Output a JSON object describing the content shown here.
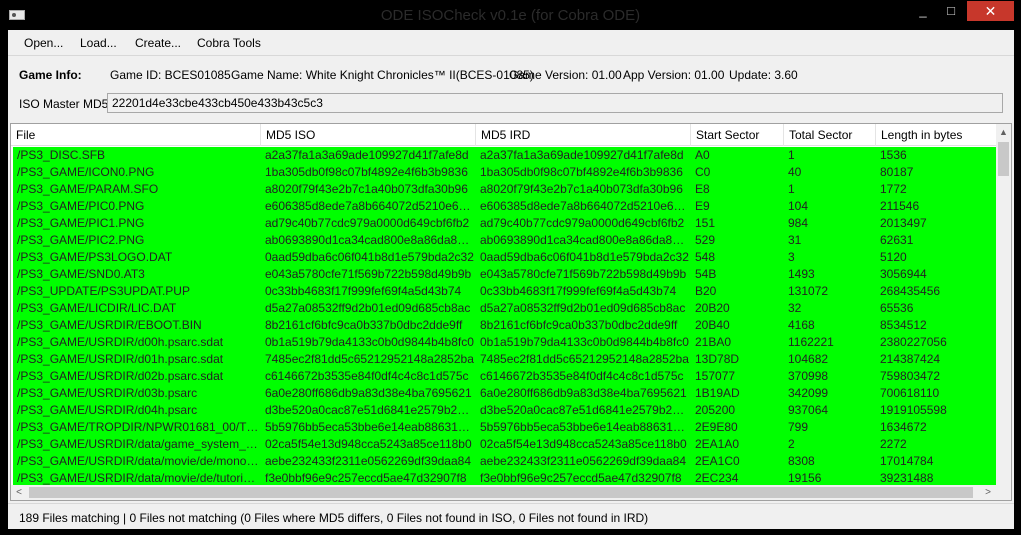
{
  "window": {
    "title": "ODE ISOCheck v0.1e (for Cobra ODE)",
    "minimize": "_",
    "maximize": "□",
    "close": "✕"
  },
  "menu": {
    "open": "Open...",
    "load": "Load...",
    "create": "Create...",
    "cobra_tools": "Cobra Tools"
  },
  "game_info": {
    "label": "Game Info:",
    "game_id": "Game ID: BCES01085",
    "game_name": "Game Name: White Knight Chronicles™ II(BCES-01085)",
    "game_version": "Game Version: 01.00",
    "app_version": "App Version: 01.00",
    "update": "Update: 3.60"
  },
  "iso_md5": {
    "label": "ISO Master MD5:",
    "value": "22201d4e33cbe433cb450e433b43c5c3"
  },
  "table": {
    "columns": [
      "File",
      "MD5 ISO",
      "MD5 IRD",
      "Start Sector",
      "Total Sector",
      "Length in bytes"
    ],
    "rows": [
      [
        "/PS3_DISC.SFB",
        "a2a37fa1a3a69ade109927d41f7afe8d",
        "a2a37fa1a3a69ade109927d41f7afe8d",
        "A0",
        "1",
        "1536"
      ],
      [
        "/PS3_GAME/ICON0.PNG",
        "1ba305db0f98c07bf4892e4f6b3b9836",
        "1ba305db0f98c07bf4892e4f6b3b9836",
        "C0",
        "40",
        "80187"
      ],
      [
        "/PS3_GAME/PARAM.SFO",
        "a8020f79f43e2b7c1a40b073dfa30b96",
        "a8020f79f43e2b7c1a40b073dfa30b96",
        "E8",
        "1",
        "1772"
      ],
      [
        "/PS3_GAME/PIC0.PNG",
        "e606385d8ede7a8b664072d5210e6d3f",
        "e606385d8ede7a8b664072d5210e6d3f",
        "E9",
        "104",
        "211546"
      ],
      [
        "/PS3_GAME/PIC1.PNG",
        "ad79c40b77cdc979a0000d649cbf6fb2",
        "ad79c40b77cdc979a0000d649cbf6fb2",
        "151",
        "984",
        "2013497"
      ],
      [
        "/PS3_GAME/PIC2.PNG",
        "ab0693890d1ca34cad800e8a86da8954",
        "ab0693890d1ca34cad800e8a86da8954",
        "529",
        "31",
        "62631"
      ],
      [
        "/PS3_GAME/PS3LOGO.DAT",
        "0aad59dba6c06f041b8d1e579bda2c32",
        "0aad59dba6c06f041b8d1e579bda2c32",
        "548",
        "3",
        "5120"
      ],
      [
        "/PS3_GAME/SND0.AT3",
        "e043a5780cfe71f569b722b598d49b9b",
        "e043a5780cfe71f569b722b598d49b9b",
        "54B",
        "1493",
        "3056944"
      ],
      [
        "/PS3_UPDATE/PS3UPDAT.PUP",
        "0c33bb4683f17f999fef69f4a5d43b74",
        "0c33bb4683f17f999fef69f4a5d43b74",
        "B20",
        "131072",
        "268435456"
      ],
      [
        "/PS3_GAME/LICDIR/LIC.DAT",
        "d5a27a08532ff9d2b01ed09d685cb8ac",
        "d5a27a08532ff9d2b01ed09d685cb8ac",
        "20B20",
        "32",
        "65536"
      ],
      [
        "/PS3_GAME/USRDIR/EBOOT.BIN",
        "8b2161cf6bfc9ca0b337b0dbc2dde9ff",
        "8b2161cf6bfc9ca0b337b0dbc2dde9ff",
        "20B40",
        "4168",
        "8534512"
      ],
      [
        "/PS3_GAME/USRDIR/d00h.psarc.sdat",
        "0b1a519b79da4133c0b0d9844b4b8fc0",
        "0b1a519b79da4133c0b0d9844b4b8fc0",
        "21BA0",
        "1162221",
        "2380227056"
      ],
      [
        "/PS3_GAME/USRDIR/d01h.psarc.sdat",
        "7485ec2f81dd5c65212952148a2852ba",
        "7485ec2f81dd5c65212952148a2852ba",
        "13D78D",
        "104682",
        "214387424"
      ],
      [
        "/PS3_GAME/USRDIR/d02b.psarc.sdat",
        "c6146672b3535e84f0df4c4c8c1d575c",
        "c6146672b3535e84f0df4c4c8c1d575c",
        "157077",
        "370998",
        "759803472"
      ],
      [
        "/PS3_GAME/USRDIR/d03b.psarc",
        "6a0e280ff686db9a83d38e4ba7695621",
        "6a0e280ff686db9a83d38e4ba7695621",
        "1B19AD",
        "342099",
        "700618110"
      ],
      [
        "/PS3_GAME/USRDIR/d04h.psarc",
        "d3be520a0cac87e51d6841e2579b2123",
        "d3be520a0cac87e51d6841e2579b2123",
        "205200",
        "937064",
        "1919105598"
      ],
      [
        "/PS3_GAME/TROPDIR/NPWR01681_00/TR...",
        "5b5976bb5eca53bbe6e14eab8863102a",
        "5b5976bb5eca53bbe6e14eab8863102a",
        "2E9E80",
        "799",
        "1634672"
      ],
      [
        "/PS3_GAME/USRDIR/data/game_system_setti...",
        "02ca5f54e13d948cca5243a85ce118b0",
        "02ca5f54e13d948cca5243a85ce118b0",
        "2EA1A0",
        "2",
        "2272"
      ],
      [
        "/PS3_GAME/USRDIR/data/movie/de/monolog...",
        "aebe232433f2311e0562269df39daa84",
        "aebe232433f2311e0562269df39daa84",
        "2EA1C0",
        "8308",
        "17014784"
      ],
      [
        "/PS3_GAME/USRDIR/data/movie/de/tutorial1...",
        "f3e0bbf96e9c257eccd5ae47d32907f8",
        "f3e0bbf96e9c257eccd5ae47d32907f8",
        "2EC234",
        "19156",
        "39231488"
      ]
    ]
  },
  "colors": {
    "match_row": "#00ff00"
  },
  "status": "189 Files matching | 0 Files not matching (0 Files where MD5 differs, 0 Files not found in ISO, 0 Files not found in IRD)"
}
